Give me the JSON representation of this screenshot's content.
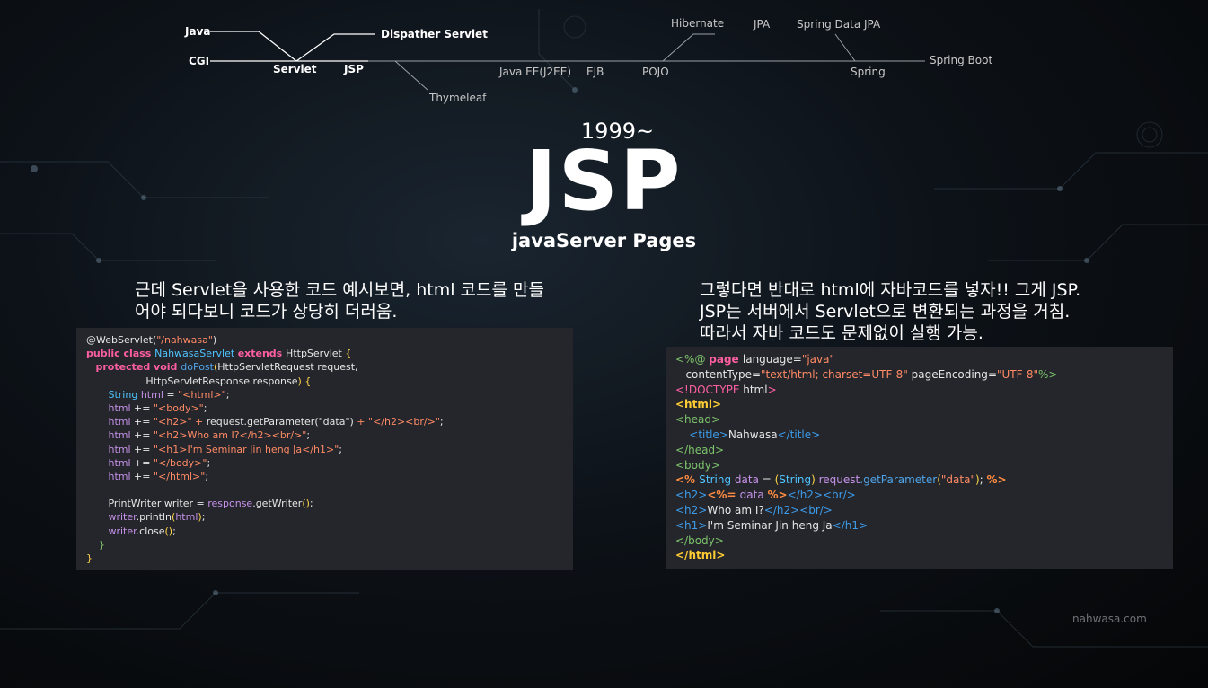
{
  "timeline": {
    "labels": {
      "java": "Java",
      "cgi": "CGI",
      "servlet": "Servlet",
      "jsp": "JSP",
      "dispatcher": "Dispather Servlet",
      "thymeleaf": "Thymeleaf",
      "javaee": "Java EE(J2EE)",
      "ejb": "EJB",
      "pojo": "POJO",
      "hibernate": "Hibernate",
      "jpa": "JPA",
      "springdatajpa": "Spring Data JPA",
      "spring": "Spring",
      "springboot": "Spring Boot"
    }
  },
  "hero": {
    "year": "1999~",
    "title": "JSP",
    "subtitle": "javaServer Pages"
  },
  "left_desc": {
    "line1": "근데 Servlet을 사용한 코드 예시보면, html 코드를 만들",
    "line2": "어야 되다보니 코드가 상당히 더러움."
  },
  "right_desc": {
    "line1": "그렇다면 반대로 html에 자바코드를 넣자!! 그게 JSP.",
    "line2": "JSP는 서버에서 Servlet으로 변환되는 과정을 거침.",
    "line3": "따라서 자바 코드도 문제없이 실행 가능."
  },
  "servlet_code": {
    "lines": [
      [
        [
          "ann",
          "@WebServlet("
        ],
        [
          "str",
          "\"/nahwasa\""
        ],
        [
          "ann",
          ")"
        ]
      ],
      [
        [
          "kw",
          "public class "
        ],
        [
          "cls",
          "NahwasaServlet "
        ],
        [
          "kw",
          "extends "
        ],
        [
          "w",
          "HttpServlet "
        ],
        [
          "br",
          "{"
        ]
      ],
      [
        [
          "w",
          "   "
        ],
        [
          "kw",
          "protected void "
        ],
        [
          "fn",
          "doPost"
        ],
        [
          "br",
          "("
        ],
        [
          "w",
          "HttpServletRequest request,"
        ]
      ],
      [
        [
          "w",
          "                   HttpServletResponse response"
        ],
        [
          "br",
          ") {"
        ]
      ],
      [
        [
          "w",
          "       "
        ],
        [
          "cls",
          "String "
        ],
        [
          "var",
          "html "
        ],
        [
          "w",
          "= "
        ],
        [
          "str",
          "\"<html>\""
        ],
        [
          "w",
          ";"
        ]
      ],
      [
        [
          "w",
          "       "
        ],
        [
          "var",
          "html "
        ],
        [
          "w",
          "+= "
        ],
        [
          "str",
          "\"<body>\""
        ],
        [
          "w",
          ";"
        ]
      ],
      [
        [
          "w",
          "       "
        ],
        [
          "var",
          "html "
        ],
        [
          "w",
          "+= "
        ],
        [
          "str",
          "\"<h2>\" + "
        ],
        [
          "w",
          "request.getParameter(\"data\") "
        ],
        [
          "str",
          "+ \"</h2><br/>\""
        ],
        [
          "w",
          ";"
        ]
      ],
      [
        [
          "w",
          "       "
        ],
        [
          "var",
          "html "
        ],
        [
          "w",
          "+= "
        ],
        [
          "str",
          "\"<h2>Who am I?</h2><br/>\""
        ],
        [
          "w",
          ";"
        ]
      ],
      [
        [
          "w",
          "       "
        ],
        [
          "var",
          "html "
        ],
        [
          "w",
          "+= "
        ],
        [
          "str",
          "\"<h1>I'm Seminar Jin heng Ja</h1>\""
        ],
        [
          "w",
          ";"
        ]
      ],
      [
        [
          "w",
          "       "
        ],
        [
          "var",
          "html "
        ],
        [
          "w",
          "+= "
        ],
        [
          "str",
          "\"</body>\""
        ],
        [
          "w",
          ";"
        ]
      ],
      [
        [
          "w",
          "       "
        ],
        [
          "var",
          "html "
        ],
        [
          "w",
          "+= "
        ],
        [
          "str",
          "\"</html>\""
        ],
        [
          "w",
          ";"
        ]
      ],
      [
        [
          "w",
          " "
        ]
      ],
      [
        [
          "w",
          "       PrintWriter writer = "
        ],
        [
          "var",
          "response"
        ],
        [
          "w",
          ".getWriter"
        ],
        [
          "br",
          "()"
        ],
        [
          "w",
          ";"
        ]
      ],
      [
        [
          "w",
          "       "
        ],
        [
          "var",
          "writer"
        ],
        [
          "w",
          ".println"
        ],
        [
          "br",
          "("
        ],
        [
          "var",
          "html"
        ],
        [
          "br",
          ")"
        ],
        [
          "w",
          ";"
        ]
      ],
      [
        [
          "w",
          "       "
        ],
        [
          "var",
          "writer"
        ],
        [
          "w",
          ".close"
        ],
        [
          "br",
          "()"
        ],
        [
          "w",
          ";"
        ]
      ],
      [
        [
          "w",
          "    "
        ],
        [
          "grn",
          "}"
        ]
      ],
      [
        [
          "br",
          "}"
        ]
      ]
    ]
  },
  "jsp_code": {
    "lines": [
      [
        [
          "grn",
          "<%@ "
        ],
        [
          "kw",
          "page "
        ],
        [
          "w",
          "language"
        ],
        [
          "w",
          "="
        ],
        [
          "str",
          "\"java\""
        ]
      ],
      [
        [
          "w",
          "   contentType"
        ],
        [
          "w",
          "="
        ],
        [
          "str",
          "\"text/html; charset=UTF-8\" "
        ],
        [
          "w",
          "pageEncoding"
        ],
        [
          "w",
          "="
        ],
        [
          "str",
          "\"UTF-8\""
        ],
        [
          "grn",
          "%>"
        ]
      ],
      [
        [
          "pink",
          "<!DOCTYPE "
        ],
        [
          "w",
          "html"
        ],
        [
          "pink",
          ">"
        ]
      ],
      [
        [
          "yl",
          "<html>"
        ]
      ],
      [
        [
          "grn",
          "<head>"
        ]
      ],
      [
        [
          "w",
          "    "
        ],
        [
          "tagc",
          "<title>"
        ],
        [
          "w",
          "Nahwasa"
        ],
        [
          "tagc",
          "</title>"
        ]
      ],
      [
        [
          "grn",
          "</head>"
        ]
      ],
      [
        [
          "grn",
          "<body>"
        ]
      ],
      [
        [
          "jspk",
          "<% "
        ],
        [
          "cls",
          "String "
        ],
        [
          "var",
          "data "
        ],
        [
          "w",
          "= "
        ],
        [
          "br",
          "("
        ],
        [
          "cls",
          "String"
        ],
        [
          "br",
          ") "
        ],
        [
          "var",
          "request"
        ],
        [
          "fn",
          ".getParameter"
        ],
        [
          "br",
          "("
        ],
        [
          "str",
          "\"data\""
        ],
        [
          "br",
          ")"
        ],
        [
          "w",
          "; "
        ],
        [
          "jspk",
          "%>"
        ]
      ],
      [
        [
          "tagc",
          "<h2>"
        ],
        [
          "jspk",
          "<%= "
        ],
        [
          "var",
          "data "
        ],
        [
          "jspk",
          "%>"
        ],
        [
          "tagc",
          "</h2><br/>"
        ]
      ],
      [
        [
          "tagc",
          "<h2>"
        ],
        [
          "w",
          "Who am I?"
        ],
        [
          "tagc",
          "</h2><br/>"
        ]
      ],
      [
        [
          "tagc",
          "<h1>"
        ],
        [
          "w",
          "I'm Seminar Jin heng Ja"
        ],
        [
          "tagc",
          "</h1>"
        ]
      ],
      [
        [
          "grn",
          "</body>"
        ]
      ],
      [
        [
          "yl",
          "</html>"
        ]
      ]
    ]
  },
  "footer": {
    "text": "nahwasa.com"
  }
}
